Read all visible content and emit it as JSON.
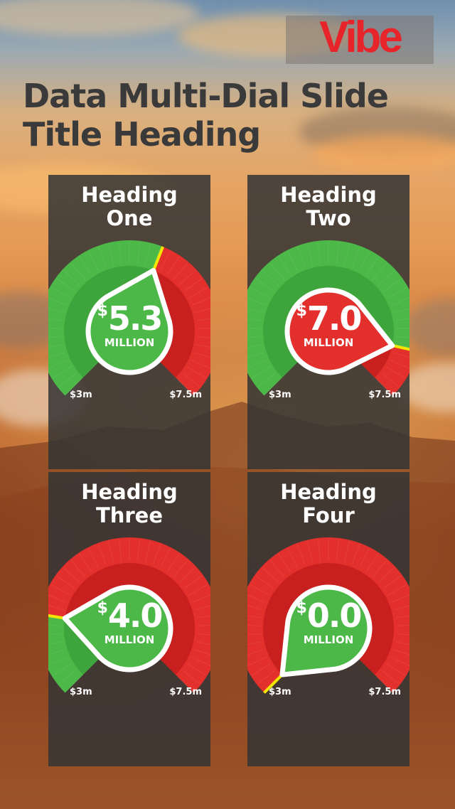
{
  "brand": {
    "logo_text": "Vibe",
    "logo_color": "#e6242a"
  },
  "title": "Data Multi-Dial Slide Title Heading",
  "colors": {
    "green": "#4cb848",
    "green_dark": "#3ea43c",
    "red": "#e3302c",
    "red_dark": "#c8201e",
    "pointer_outline": "#ffffff",
    "needle": "#f2e600"
  },
  "dials": [
    {
      "heading": "Heading\nOne",
      "currency": "$",
      "value": "5.3",
      "unit": "MILLION",
      "min_label": "$3m",
      "max_label": "$7.5m",
      "fraction": 0.58,
      "state": "good"
    },
    {
      "heading": "Heading\nTwo",
      "currency": "$",
      "value": "7.0",
      "unit": "MILLION",
      "min_label": "$3m",
      "max_label": "$7.5m",
      "fraction": 0.88,
      "state": "bad"
    },
    {
      "heading": "Heading\nThree",
      "currency": "$",
      "value": "4.0",
      "unit": "MILLION",
      "min_label": "$3m",
      "max_label": "$7.5m",
      "fraction": 0.2,
      "state": "good"
    },
    {
      "heading": "Heading\nFour",
      "currency": "$",
      "value": "0.0",
      "unit": "MILLION",
      "min_label": "$3m",
      "max_label": "$7.5m",
      "fraction": 0.0,
      "state": "good"
    }
  ]
}
